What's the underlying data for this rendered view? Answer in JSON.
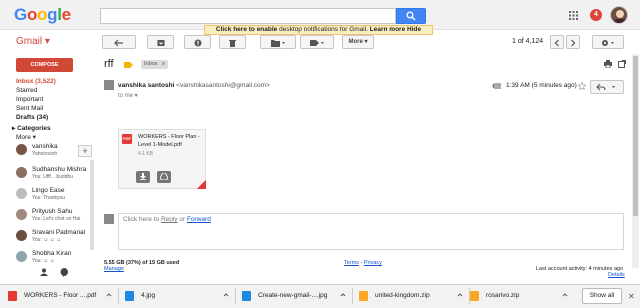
{
  "header": {
    "logo_letters": [
      {
        "ch": "G",
        "color": "#4285f4"
      },
      {
        "ch": "o",
        "color": "#ea4335"
      },
      {
        "ch": "o",
        "color": "#fbbc05"
      },
      {
        "ch": "g",
        "color": "#4285f4"
      },
      {
        "ch": "l",
        "color": "#34a853"
      },
      {
        "ch": "e",
        "color": "#ea4335"
      }
    ],
    "search_value": "",
    "notification_count": "4",
    "banner": {
      "link": "Click here to enable",
      "text": " desktop notifications for Gmail.",
      "learn_more": "Learn more",
      "hide": "Hide"
    }
  },
  "toolbar": {
    "gmail_label": "Gmail ▾",
    "more_label": "More ▾",
    "count_label": "1 of 4,124"
  },
  "sidebar": {
    "compose_label": "COMPOSE",
    "nav": [
      {
        "label": "Inbox (3,522)",
        "bold": true,
        "color": "#d14836"
      },
      {
        "label": "Starred",
        "bold": false,
        "color": "#222"
      },
      {
        "label": "Important",
        "bold": false,
        "color": "#222"
      },
      {
        "label": "Sent Mail",
        "bold": false,
        "color": "#222"
      },
      {
        "label": "Drafts (34)",
        "bold": true,
        "color": "#222"
      }
    ],
    "categories_label": "▸ Categories",
    "more_label": "More ▾",
    "chat_me": {
      "name": "vanshika",
      "status": "Yahoooooh"
    },
    "contacts": [
      {
        "name": "Sudhanshu Mishra",
        "status": "You: Ufff... buddhu"
      },
      {
        "name": "Lingo Ease",
        "status": "You: Thankyou"
      },
      {
        "name": "Prityush Sahu",
        "status": "You: Let's chat on Hai"
      },
      {
        "name": "Sravani Padmanal",
        "status": "You: ☺ ☺ ☺"
      },
      {
        "name": "Shobha Kiran",
        "status": "You: ☺ ☺"
      }
    ]
  },
  "thread": {
    "subject": "rff",
    "label": "Inbox",
    "label_close": "x",
    "sender_name": "vanshika santoshi",
    "sender_email": "<vanshikasantoshi@gmail.com>",
    "to": "to me ▾",
    "time": "1:39 AM (5 minutes ago)",
    "attachment": {
      "name": "WORKERS - Floor Plan - Level 1-Model.pdf",
      "size": "4.1 KB",
      "type_badge": "PDF"
    },
    "reply_prefix": "Click here to ",
    "reply_link": "Reply",
    "reply_or": " or ",
    "forward_link": "Forward"
  },
  "footer": {
    "storage": "5.55 GB (37%) of 15 GB used",
    "manage": "Manage",
    "terms": "Terms",
    "sep": " - ",
    "privacy": "Privacy",
    "activity": "Last account activity: 4 minutes ago",
    "details": "Details"
  },
  "downloads": {
    "items": [
      {
        "name": "WORKERS - Floor ....pdf",
        "icon_color": "#e53935"
      },
      {
        "name": "4.jpg",
        "icon_color": "#1e88e5"
      },
      {
        "name": "Create-new-gmail-....jpg",
        "icon_color": "#1e88e5"
      },
      {
        "name": "united-kingdom.zip",
        "icon_color": "#f9a825"
      },
      {
        "name": "rosarivo.zip",
        "icon_color": "#f9a825"
      }
    ],
    "show_all": "Show all",
    "close": "✕"
  }
}
